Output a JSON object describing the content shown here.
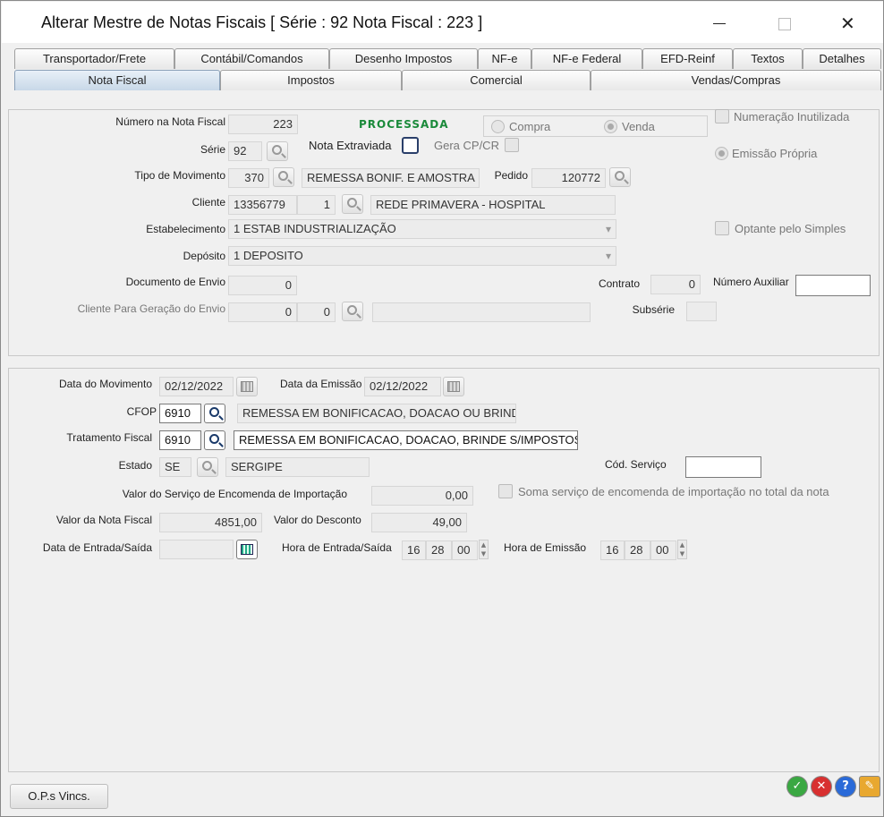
{
  "window": {
    "title": "Alterar Mestre de Notas Fiscais [ Série : 92  Nota Fiscal : 223 ]",
    "close_glyph": "✕"
  },
  "tabs_top": [
    "Transportador/Frete",
    "Contábil/Comandos",
    "Desenho Impostos",
    "NF-e",
    "NF-e Federal",
    "EFD-Reinf",
    "Textos",
    "Detalhes"
  ],
  "tabs_bottom": [
    "Nota Fiscal",
    "Impostos",
    "Comercial",
    "Vendas/Compras"
  ],
  "top_section": {
    "numero_label": "Número na Nota Fiscal",
    "numero_value": "223",
    "status": "PROCESSADA",
    "compra_label": "Compra",
    "venda_label": "Venda",
    "numeracao_inutilizada_label": "Numeração Inutilizada",
    "serie_label": "Série",
    "serie_value": "92",
    "nota_extraviada_label": "Nota Extraviada",
    "gera_cpcr_label": "Gera CP/CR",
    "emissao_propria_label": "Emissão Própria",
    "tipo_mov_label": "Tipo de Movimento",
    "tipo_mov_code": "370",
    "tipo_mov_desc": "REMESSA BONIF. E AMOSTRA",
    "pedido_label": "Pedido",
    "pedido_value": "120772",
    "cliente_label": "Cliente",
    "cliente_code": "13356779",
    "cliente_seq": "1",
    "cliente_name": "REDE PRIMAVERA - HOSPITAL",
    "estab_label": "Estabelecimento",
    "estab_value": "1 ESTAB INDUSTRIALIZAÇÃO",
    "optante_label": "Optante pelo Simples",
    "deposito_label": "Depósito",
    "deposito_value": "1 DEPOSITO",
    "doc_envio_label": "Documento de Envio",
    "doc_envio_value": "0",
    "contrato_label": "Contrato",
    "contrato_value": "0",
    "num_aux_label": "Número Auxiliar",
    "num_aux_value": "",
    "cliente_envio_label": "Cliente Para Geração do Envio",
    "cliente_envio_code": "0",
    "cliente_envio_seq": "0",
    "subserie_label": "Subsérie"
  },
  "bottom_section": {
    "data_mov_label": "Data do Movimento",
    "data_mov_value": "02/12/2022",
    "data_emissao_label": "Data da Emissão",
    "data_emissao_value": "02/12/2022",
    "cfop_label": "CFOP",
    "cfop_code": "6910",
    "cfop_desc": "REMESSA EM BONIFICACAO, DOACAO OU BRINDE",
    "trat_fiscal_label": "Tratamento Fiscal",
    "trat_fiscal_code": "6910",
    "trat_fiscal_desc": "REMESSA EM BONIFICACAO, DOACAO, BRINDE S/IMPOSTOS",
    "estado_label": "Estado",
    "estado_code": "SE",
    "estado_name": "SERGIPE",
    "cod_servico_label": "Cód. Serviço",
    "valor_servico_label": "Valor do Serviço de Encomenda de Importação",
    "valor_servico_value": "0,00",
    "soma_servico_label": "Soma serviço de encomenda de importação no total da nota",
    "valor_nf_label": "Valor da Nota Fiscal",
    "valor_nf_value": "4851,00",
    "valor_desc_label": "Valor do Desconto",
    "valor_desc_value": "49,00",
    "data_entrada_label": "Data de Entrada/Saída",
    "hora_entrada_label": "Hora de Entrada/Saída",
    "hora_entrada_h": "16",
    "hora_entrada_m": "28",
    "hora_entrada_s": "00",
    "hora_emissao_label": "Hora de Emissão",
    "hora_emissao_h": "16",
    "hora_emissao_m": "28",
    "hora_emissao_s": "00"
  },
  "footer": {
    "ops_button": "O.P.s Vincs.",
    "ok_glyph": "✓",
    "cancel_glyph": "✕",
    "help_glyph": "?",
    "tool_glyph": "✎"
  }
}
